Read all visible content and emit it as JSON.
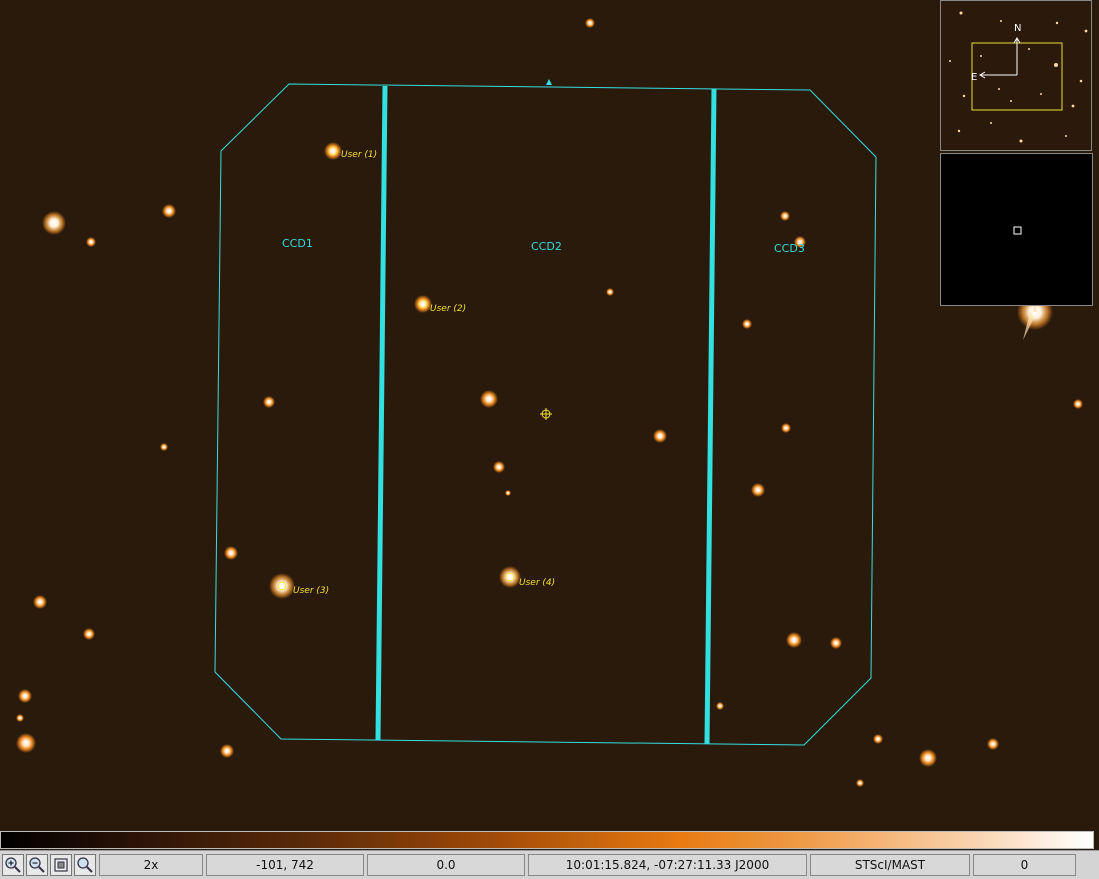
{
  "viewer": {
    "ccd_labels": [
      "CCD1",
      "CCD2",
      "CCD3"
    ],
    "targets": [
      {
        "label": "User (1)"
      },
      {
        "label": "User (2)"
      },
      {
        "label": "User (3)"
      },
      {
        "label": "User (4)"
      }
    ]
  },
  "panner": {
    "north": "N",
    "east": "E"
  },
  "colorbar": {
    "colormap": "heat"
  },
  "toolbar": {
    "icons": [
      "zoom-in-icon",
      "zoom-out-icon",
      "zoom-fit-icon",
      "zoom-actual-icon"
    ]
  },
  "status": {
    "zoom": "2x",
    "pixel": "-101, 742",
    "value": "0.0",
    "wcs": "10:01:15.824, -07:27:11.33 J2000",
    "source": "STScI/MAST",
    "extra": "0"
  },
  "colors": {
    "footprint": "#33e0e0",
    "marker": "#f0e030",
    "background": "#2a1a0c"
  }
}
